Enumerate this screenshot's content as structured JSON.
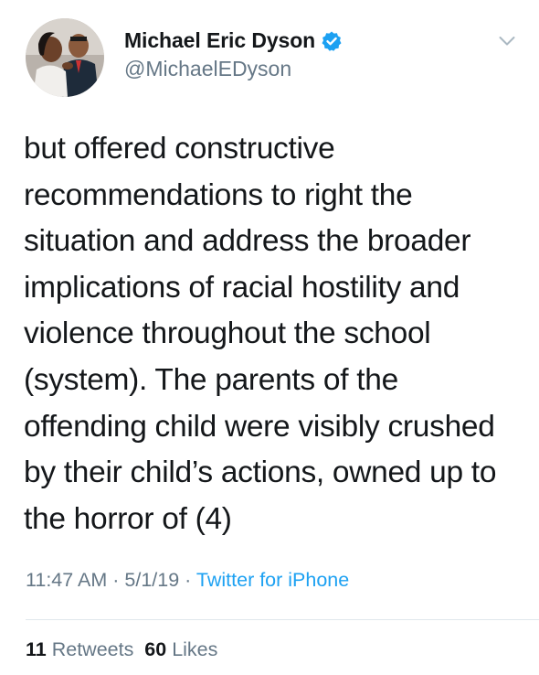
{
  "author": {
    "display_name": "Michael Eric Dyson",
    "handle": "@MichaelEDyson",
    "verified": true,
    "avatar_icon": "profile-photo"
  },
  "tweet": {
    "text": "but offered constructive\nrecommendations to right the\nsituation and address the broader\nimplications of racial hostility and\nviolence throughout the school\n(system). The parents of the\noffending child were visibly crushed\nby their child’s actions, owned up to\nthe horror of (4)",
    "time": "11:47 AM",
    "separator": "·",
    "date": "5/1/19",
    "source": "Twitter for iPhone"
  },
  "stats": {
    "retweets_count": "11",
    "retweets_label": "Retweets",
    "likes_count": "60",
    "likes_label": "Likes"
  },
  "colors": {
    "accent": "#1da1f2",
    "muted": "#657786",
    "text": "#14171a",
    "divider": "#e1e8ed"
  },
  "icons": {
    "verified": "verified-badge-icon",
    "menu": "chevron-down-icon"
  }
}
